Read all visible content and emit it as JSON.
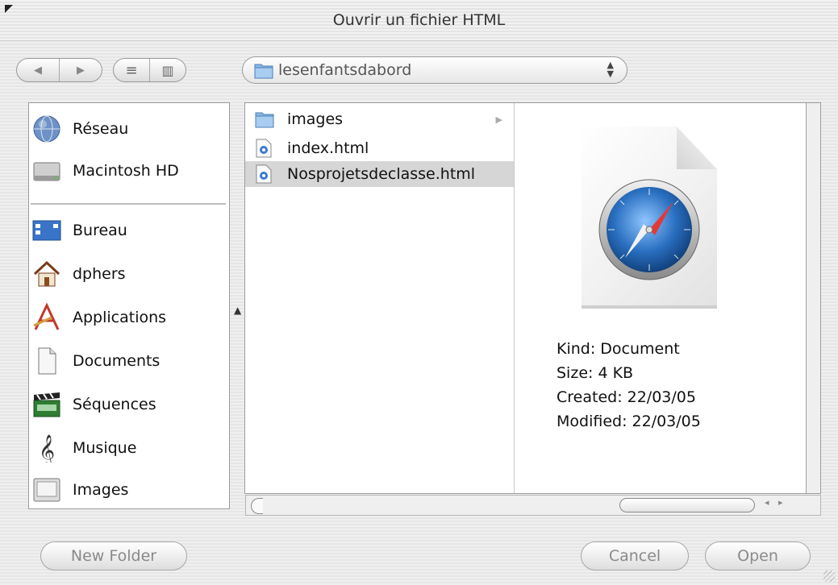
{
  "window": {
    "title": "Ouvrir un fichier HTML"
  },
  "toolbar": {
    "back_glyph": "◀",
    "forward_glyph": "▶",
    "list_view_glyph": "≡",
    "column_view_glyph": "▥",
    "location": "lesenfantsdabord",
    "location_arrows": "▲▼"
  },
  "sidebar": {
    "devices": [
      {
        "label": "Réseau",
        "icon": "network-globe-icon"
      },
      {
        "label": "Macintosh HD",
        "icon": "hard-drive-icon"
      }
    ],
    "places": [
      {
        "label": "Bureau",
        "icon": "desktop-icon"
      },
      {
        "label": "dphers",
        "icon": "home-icon"
      },
      {
        "label": "Applications",
        "icon": "applications-icon"
      },
      {
        "label": "Documents",
        "icon": "documents-icon"
      },
      {
        "label": "Séquences",
        "icon": "movies-clapper-icon"
      },
      {
        "label": "Musique",
        "icon": "music-clef-icon"
      },
      {
        "label": "Images",
        "icon": "pictures-icon"
      }
    ]
  },
  "browser": {
    "items": [
      {
        "name": "images",
        "type": "folder",
        "disclosure": "▶"
      },
      {
        "name": "index.html",
        "type": "html-file"
      },
      {
        "name": "Nosprojetsdeclasse.html",
        "type": "html-file",
        "selected": true
      }
    ]
  },
  "preview": {
    "icon": "safari-document-icon",
    "kind": "Kind: Document",
    "size": "Size: 4 KB",
    "created": "Created: 22/03/05",
    "modified": "Modified: 22/03/05"
  },
  "scroll": {
    "arrows": "◂ ▸"
  },
  "buttons": {
    "new_folder": "New Folder",
    "cancel": "Cancel",
    "open": "Open"
  },
  "colors": {
    "selection": "#d6d6d6",
    "folder": "#7fb0e0",
    "compass": "#2a6fc0"
  }
}
